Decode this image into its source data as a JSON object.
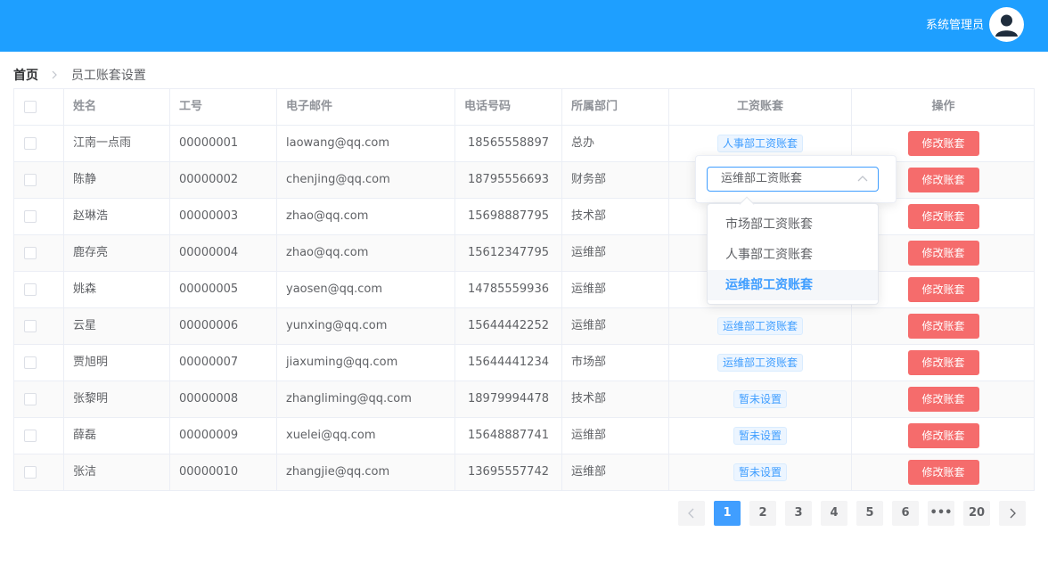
{
  "header": {
    "user_name": "系统管理员"
  },
  "breadcrumb": {
    "home": "首页",
    "current": "员工账套设置"
  },
  "table": {
    "columns": [
      "姓名",
      "工号",
      "电子邮件",
      "电话号码",
      "所属部门",
      "工资账套",
      "操作"
    ],
    "rows": [
      {
        "name": "江南一点雨",
        "id": "00000001",
        "email": "laowang@qq.com",
        "phone": "18565558897",
        "dept": "总办",
        "salary": "人事部工资账套",
        "action": "修改账套"
      },
      {
        "name": "陈静",
        "id": "00000002",
        "email": "chenjing@qq.com",
        "phone": "18795556693",
        "dept": "财务部",
        "salary": "",
        "action": "修改账套"
      },
      {
        "name": "赵琳浩",
        "id": "00000003",
        "email": "zhao@qq.com",
        "phone": "15698887795",
        "dept": "技术部",
        "salary": "",
        "action": "修改账套"
      },
      {
        "name": "鹿存亮",
        "id": "00000004",
        "email": "zhao@qq.com",
        "phone": "15612347795",
        "dept": "运维部",
        "salary": "",
        "action": "修改账套"
      },
      {
        "name": "姚森",
        "id": "00000005",
        "email": "yaosen@qq.com",
        "phone": "14785559936",
        "dept": "运维部",
        "salary": "",
        "action": "修改账套"
      },
      {
        "name": "云星",
        "id": "00000006",
        "email": "yunxing@qq.com",
        "phone": "15644442252",
        "dept": "运维部",
        "salary": "运维部工资账套",
        "action": "修改账套"
      },
      {
        "name": "贾旭明",
        "id": "00000007",
        "email": "jiaxuming@qq.com",
        "phone": "15644441234",
        "dept": "市场部",
        "salary": "运维部工资账套",
        "action": "修改账套"
      },
      {
        "name": "张黎明",
        "id": "00000008",
        "email": "zhangliming@qq.com",
        "phone": "18979994478",
        "dept": "技术部",
        "salary": "暂未设置",
        "action": "修改账套"
      },
      {
        "name": "薛磊",
        "id": "00000009",
        "email": "xuelei@qq.com",
        "phone": "15648887741",
        "dept": "运维部",
        "salary": "暂未设置",
        "action": "修改账套"
      },
      {
        "name": "张洁",
        "id": "00000010",
        "email": "zhangjie@qq.com",
        "phone": "13695557742",
        "dept": "运维部",
        "salary": "暂未设置",
        "action": "修改账套"
      }
    ]
  },
  "salary_select": {
    "value": "运维部工资账套",
    "options": [
      "市场部工资账套",
      "人事部工资账套",
      "运维部工资账套"
    ],
    "selected_index": 2
  },
  "pagination": {
    "pages": [
      "1",
      "2",
      "3",
      "4",
      "5",
      "6",
      "•••",
      "20"
    ],
    "current": "1"
  },
  "colors": {
    "header": "#1e9fff",
    "primary": "#409eff",
    "danger": "#f56c6c"
  }
}
